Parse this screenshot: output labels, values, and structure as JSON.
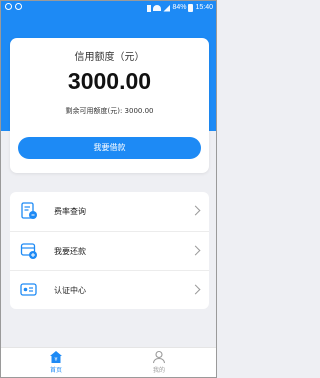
{
  "status_bar": {
    "battery": "84%",
    "time": "15:40"
  },
  "credit": {
    "title": "信用额度（元）",
    "amount": "3000.00",
    "remaining": "剩余可用额度(元): 3000.00",
    "borrow_label": "我要借款"
  },
  "menu": {
    "items": [
      {
        "label": "费率查询",
        "icon": "rate-query-icon"
      },
      {
        "label": "我要还款",
        "icon": "repay-icon"
      },
      {
        "label": "认证中心",
        "icon": "certification-icon"
      }
    ]
  },
  "tabs": [
    {
      "label": "首页",
      "icon": "home-icon",
      "active": true
    },
    {
      "label": "我的",
      "icon": "profile-icon",
      "active": false
    }
  ],
  "colors": {
    "accent": "#1d8af5",
    "background": "#eeeff3",
    "inactive": "#9a9a9a"
  }
}
